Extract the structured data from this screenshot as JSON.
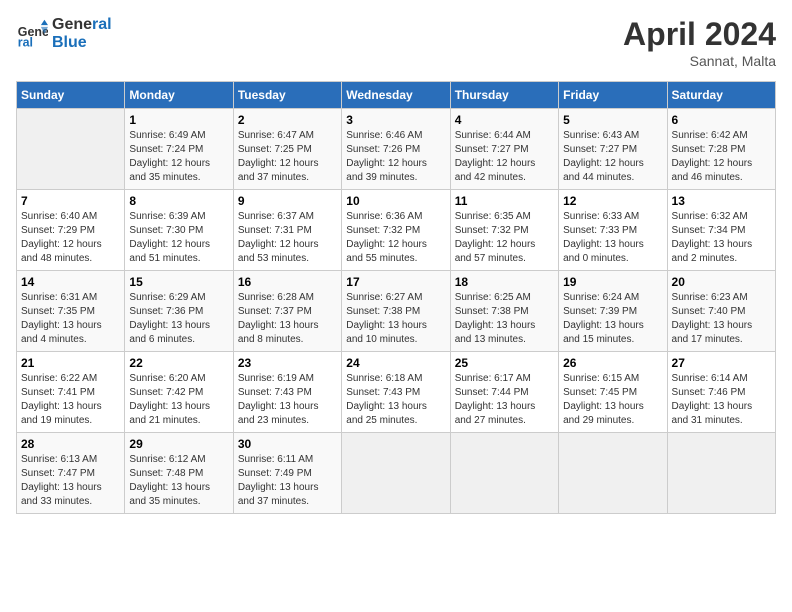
{
  "header": {
    "logo_line1": "General",
    "logo_line2": "Blue",
    "month": "April 2024",
    "location": "Sannat, Malta"
  },
  "columns": [
    "Sunday",
    "Monday",
    "Tuesday",
    "Wednesday",
    "Thursday",
    "Friday",
    "Saturday"
  ],
  "weeks": [
    [
      {
        "day": "",
        "empty": true
      },
      {
        "day": "1",
        "sunrise": "Sunrise: 6:49 AM",
        "sunset": "Sunset: 7:24 PM",
        "daylight": "Daylight: 12 hours and 35 minutes."
      },
      {
        "day": "2",
        "sunrise": "Sunrise: 6:47 AM",
        "sunset": "Sunset: 7:25 PM",
        "daylight": "Daylight: 12 hours and 37 minutes."
      },
      {
        "day": "3",
        "sunrise": "Sunrise: 6:46 AM",
        "sunset": "Sunset: 7:26 PM",
        "daylight": "Daylight: 12 hours and 39 minutes."
      },
      {
        "day": "4",
        "sunrise": "Sunrise: 6:44 AM",
        "sunset": "Sunset: 7:27 PM",
        "daylight": "Daylight: 12 hours and 42 minutes."
      },
      {
        "day": "5",
        "sunrise": "Sunrise: 6:43 AM",
        "sunset": "Sunset: 7:27 PM",
        "daylight": "Daylight: 12 hours and 44 minutes."
      },
      {
        "day": "6",
        "sunrise": "Sunrise: 6:42 AM",
        "sunset": "Sunset: 7:28 PM",
        "daylight": "Daylight: 12 hours and 46 minutes."
      }
    ],
    [
      {
        "day": "7",
        "sunrise": "Sunrise: 6:40 AM",
        "sunset": "Sunset: 7:29 PM",
        "daylight": "Daylight: 12 hours and 48 minutes."
      },
      {
        "day": "8",
        "sunrise": "Sunrise: 6:39 AM",
        "sunset": "Sunset: 7:30 PM",
        "daylight": "Daylight: 12 hours and 51 minutes."
      },
      {
        "day": "9",
        "sunrise": "Sunrise: 6:37 AM",
        "sunset": "Sunset: 7:31 PM",
        "daylight": "Daylight: 12 hours and 53 minutes."
      },
      {
        "day": "10",
        "sunrise": "Sunrise: 6:36 AM",
        "sunset": "Sunset: 7:32 PM",
        "daylight": "Daylight: 12 hours and 55 minutes."
      },
      {
        "day": "11",
        "sunrise": "Sunrise: 6:35 AM",
        "sunset": "Sunset: 7:32 PM",
        "daylight": "Daylight: 12 hours and 57 minutes."
      },
      {
        "day": "12",
        "sunrise": "Sunrise: 6:33 AM",
        "sunset": "Sunset: 7:33 PM",
        "daylight": "Daylight: 13 hours and 0 minutes."
      },
      {
        "day": "13",
        "sunrise": "Sunrise: 6:32 AM",
        "sunset": "Sunset: 7:34 PM",
        "daylight": "Daylight: 13 hours and 2 minutes."
      }
    ],
    [
      {
        "day": "14",
        "sunrise": "Sunrise: 6:31 AM",
        "sunset": "Sunset: 7:35 PM",
        "daylight": "Daylight: 13 hours and 4 minutes."
      },
      {
        "day": "15",
        "sunrise": "Sunrise: 6:29 AM",
        "sunset": "Sunset: 7:36 PM",
        "daylight": "Daylight: 13 hours and 6 minutes."
      },
      {
        "day": "16",
        "sunrise": "Sunrise: 6:28 AM",
        "sunset": "Sunset: 7:37 PM",
        "daylight": "Daylight: 13 hours and 8 minutes."
      },
      {
        "day": "17",
        "sunrise": "Sunrise: 6:27 AM",
        "sunset": "Sunset: 7:38 PM",
        "daylight": "Daylight: 13 hours and 10 minutes."
      },
      {
        "day": "18",
        "sunrise": "Sunrise: 6:25 AM",
        "sunset": "Sunset: 7:38 PM",
        "daylight": "Daylight: 13 hours and 13 minutes."
      },
      {
        "day": "19",
        "sunrise": "Sunrise: 6:24 AM",
        "sunset": "Sunset: 7:39 PM",
        "daylight": "Daylight: 13 hours and 15 minutes."
      },
      {
        "day": "20",
        "sunrise": "Sunrise: 6:23 AM",
        "sunset": "Sunset: 7:40 PM",
        "daylight": "Daylight: 13 hours and 17 minutes."
      }
    ],
    [
      {
        "day": "21",
        "sunrise": "Sunrise: 6:22 AM",
        "sunset": "Sunset: 7:41 PM",
        "daylight": "Daylight: 13 hours and 19 minutes."
      },
      {
        "day": "22",
        "sunrise": "Sunrise: 6:20 AM",
        "sunset": "Sunset: 7:42 PM",
        "daylight": "Daylight: 13 hours and 21 minutes."
      },
      {
        "day": "23",
        "sunrise": "Sunrise: 6:19 AM",
        "sunset": "Sunset: 7:43 PM",
        "daylight": "Daylight: 13 hours and 23 minutes."
      },
      {
        "day": "24",
        "sunrise": "Sunrise: 6:18 AM",
        "sunset": "Sunset: 7:43 PM",
        "daylight": "Daylight: 13 hours and 25 minutes."
      },
      {
        "day": "25",
        "sunrise": "Sunrise: 6:17 AM",
        "sunset": "Sunset: 7:44 PM",
        "daylight": "Daylight: 13 hours and 27 minutes."
      },
      {
        "day": "26",
        "sunrise": "Sunrise: 6:15 AM",
        "sunset": "Sunset: 7:45 PM",
        "daylight": "Daylight: 13 hours and 29 minutes."
      },
      {
        "day": "27",
        "sunrise": "Sunrise: 6:14 AM",
        "sunset": "Sunset: 7:46 PM",
        "daylight": "Daylight: 13 hours and 31 minutes."
      }
    ],
    [
      {
        "day": "28",
        "sunrise": "Sunrise: 6:13 AM",
        "sunset": "Sunset: 7:47 PM",
        "daylight": "Daylight: 13 hours and 33 minutes."
      },
      {
        "day": "29",
        "sunrise": "Sunrise: 6:12 AM",
        "sunset": "Sunset: 7:48 PM",
        "daylight": "Daylight: 13 hours and 35 minutes."
      },
      {
        "day": "30",
        "sunrise": "Sunrise: 6:11 AM",
        "sunset": "Sunset: 7:49 PM",
        "daylight": "Daylight: 13 hours and 37 minutes."
      },
      {
        "day": "",
        "empty": true
      },
      {
        "day": "",
        "empty": true
      },
      {
        "day": "",
        "empty": true
      },
      {
        "day": "",
        "empty": true
      }
    ]
  ]
}
